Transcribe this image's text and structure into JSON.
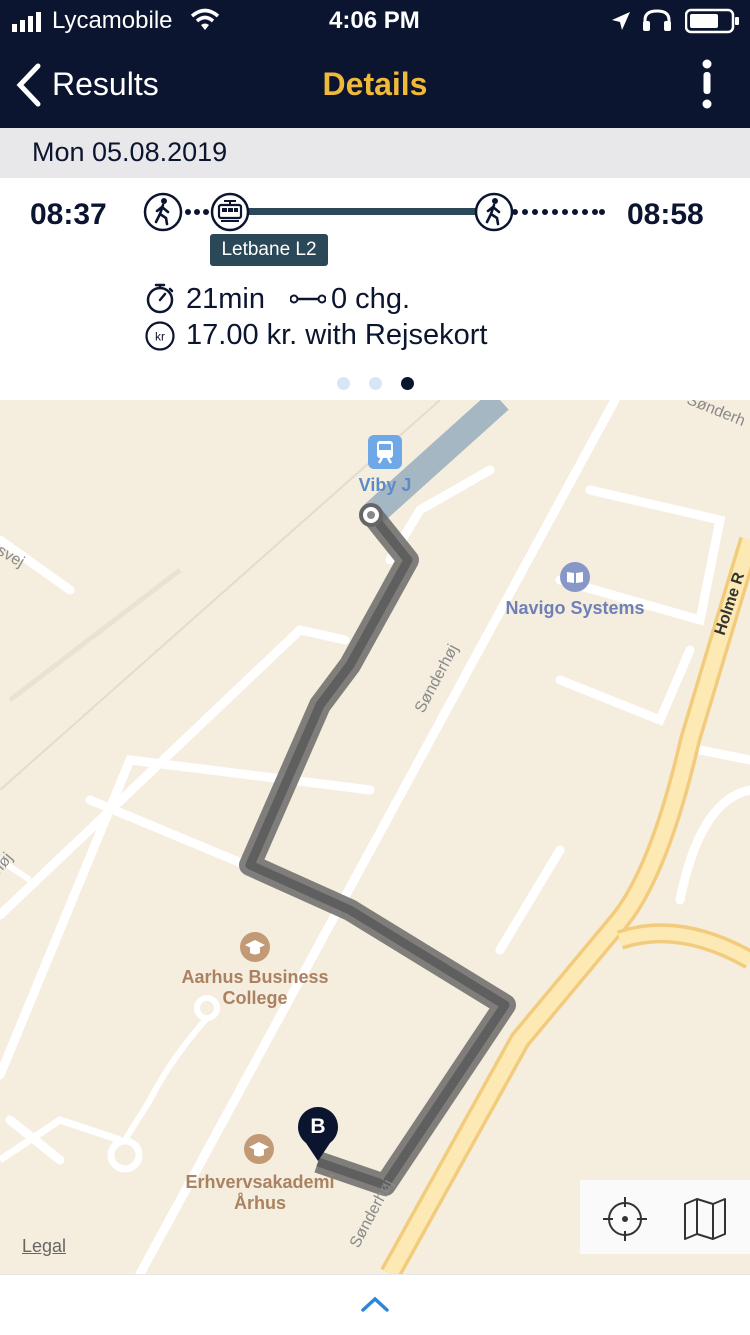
{
  "status": {
    "carrier": "Lycamobile",
    "time": "4:06 PM"
  },
  "nav": {
    "back_label": "Results",
    "title": "Details"
  },
  "date": "Mon 05.08.2019",
  "trip": {
    "depart": "08:37",
    "arrive": "08:58",
    "line_tag": "Letbane L2",
    "duration": "21min",
    "changes": "0 chg.",
    "price": "17.00 kr. with Rejsekort",
    "currency_symbol": "kr",
    "page_dots": {
      "count": 3,
      "active_index": 2
    }
  },
  "map": {
    "station": "Viby J",
    "pois": [
      "Navigo Systems",
      "Aarhus Business College",
      "Erhvervsakademi Århus"
    ],
    "streets": [
      "Sønderhøj",
      "Sønderhøj",
      "Sønderh",
      "Holme R",
      "svej",
      "høj"
    ],
    "destination_marker": "B",
    "legal": "Legal"
  },
  "colors": {
    "nav_bg": "#0b1530",
    "title_accent": "#f0b93a",
    "route_line": "#2a4857",
    "walk_route": "#5f5f5f",
    "map_bg": "#f5eedf",
    "highway": "#f7c76a"
  },
  "icons": [
    "chevron-left-icon",
    "more-vertical-icon",
    "walk-icon",
    "tram-icon",
    "stopwatch-icon",
    "changes-icon",
    "currency-icon",
    "train-station-icon",
    "book-icon",
    "school-icon",
    "location-pin-icon",
    "locate-icon",
    "map-icon",
    "chevron-up-icon"
  ]
}
